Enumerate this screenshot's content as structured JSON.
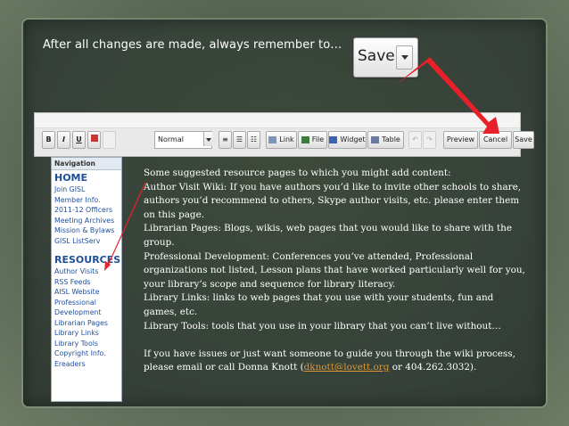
{
  "headline": "After all changes are made, always remember to…",
  "big_save": {
    "label": "Save"
  },
  "toolbar": {
    "bold": "B",
    "italic": "I",
    "underline": "U",
    "format_select": "Normal",
    "link": "Link",
    "file": "File",
    "widget": "Widget",
    "table": "Table",
    "preview": "Preview",
    "cancel": "Cancel",
    "save": "Save"
  },
  "navigation": {
    "title": "Navigation",
    "home": "HOME",
    "home_items": [
      "Join GISL",
      "Member Info.",
      "2011-12 Officers",
      "Meeting Archives",
      "Mission & Bylaws",
      "GISL ListServ"
    ],
    "resources": "RESOURCES",
    "resource_items": [
      "Author Visits",
      "RSS Feeds",
      "AISL Website",
      "Professional",
      "Development",
      "Librarian Pages",
      "Library Links",
      "Library Tools",
      "Copyright Info.",
      "Ereaders"
    ]
  },
  "content": {
    "intro": "Some suggested resource pages to which you might add content:",
    "author_visit": "Author Visit Wiki: If you have authors you’d like to invite other schools to share, authors you’d recommend to others, Skype author visits, etc. please enter them on this page.",
    "librarian_pages": "Librarian Pages: Blogs, wikis, web pages that you would like to share with the group.",
    "professional_dev": "Professional Development: Conferences you’ve attended, Professional organizations not listed, Lesson plans that have worked particularly well for you, your library’s scope and sequence for library literacy.",
    "library_links": "Library Links: links to web pages that you use with your students, fun and games, etc.",
    "library_tools": "Library Tools: tools that you use in your library that you can’t live without…",
    "help_before": "If you have issues or just want someone to guide you through the wiki process, please email or call Donna Knott (",
    "email": "dknott@lovett.org",
    "help_after": " or 404.262.3032)."
  },
  "colors": {
    "arrow_red": "#e8202a",
    "link_orange": "#d9973a",
    "nav_blue": "#1d4e9c"
  }
}
